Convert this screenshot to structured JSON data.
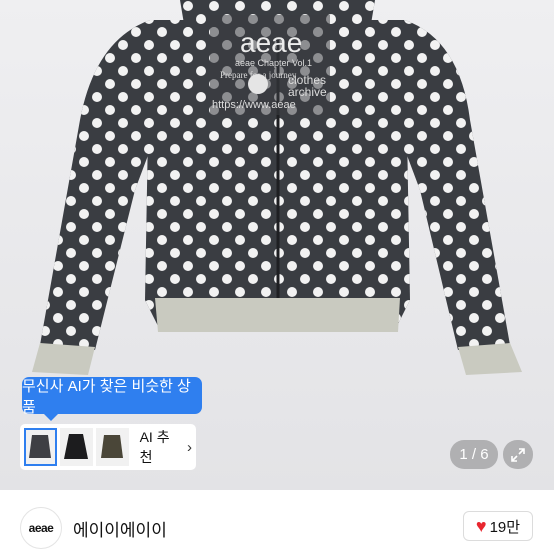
{
  "product_image": {
    "print_logo": "aeae",
    "print_lines": [
      "aeae Chapter Vol.1",
      "Prepare for a journey",
      "clothes",
      "archive",
      "https://www.aeae"
    ]
  },
  "ai_recommend": {
    "bubble_text": "무신사 AI가 찾은 비슷한 상품",
    "button_label": "AI 추천",
    "chevron": "›"
  },
  "image_counter": "1 / 6",
  "brand": {
    "logo_text": "aeae",
    "name": "에이이에이이"
  },
  "like": {
    "count": "19만",
    "icon": "heart-icon"
  },
  "colors": {
    "accent": "#2f7fef",
    "heart": "#e8262f",
    "garment": "#3a3d42",
    "ribbing": "#c9cac0"
  }
}
